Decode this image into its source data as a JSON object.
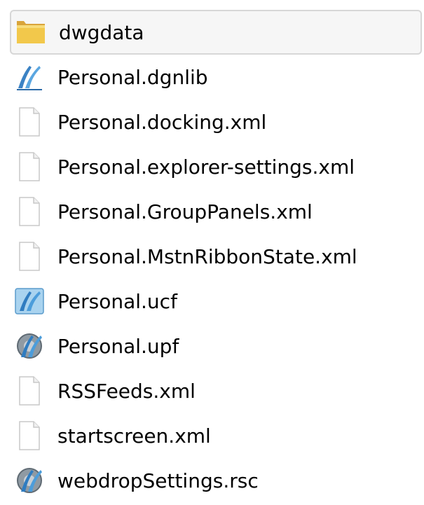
{
  "files": [
    {
      "name": "dwgdata",
      "icon": "folder-icon",
      "selected": true
    },
    {
      "name": "Personal.dgnlib",
      "icon": "microstation-dgnlib-icon",
      "selected": false
    },
    {
      "name": "Personal.docking.xml",
      "icon": "blank-file-icon",
      "selected": false
    },
    {
      "name": "Personal.explorer-settings.xml",
      "icon": "blank-file-icon",
      "selected": false
    },
    {
      "name": "Personal.GroupPanels.xml",
      "icon": "blank-file-icon",
      "selected": false
    },
    {
      "name": "Personal.MstnRibbonState.xml",
      "icon": "blank-file-icon",
      "selected": false
    },
    {
      "name": "Personal.ucf",
      "icon": "microstation-ucf-icon",
      "selected": false
    },
    {
      "name": "Personal.upf",
      "icon": "microstation-upf-icon",
      "selected": false
    },
    {
      "name": "RSSFeeds.xml",
      "icon": "blank-file-icon",
      "selected": false
    },
    {
      "name": "startscreen.xml",
      "icon": "blank-file-icon",
      "selected": false
    },
    {
      "name": "webdropSettings.rsc",
      "icon": "microstation-rsc-icon",
      "selected": false
    }
  ]
}
